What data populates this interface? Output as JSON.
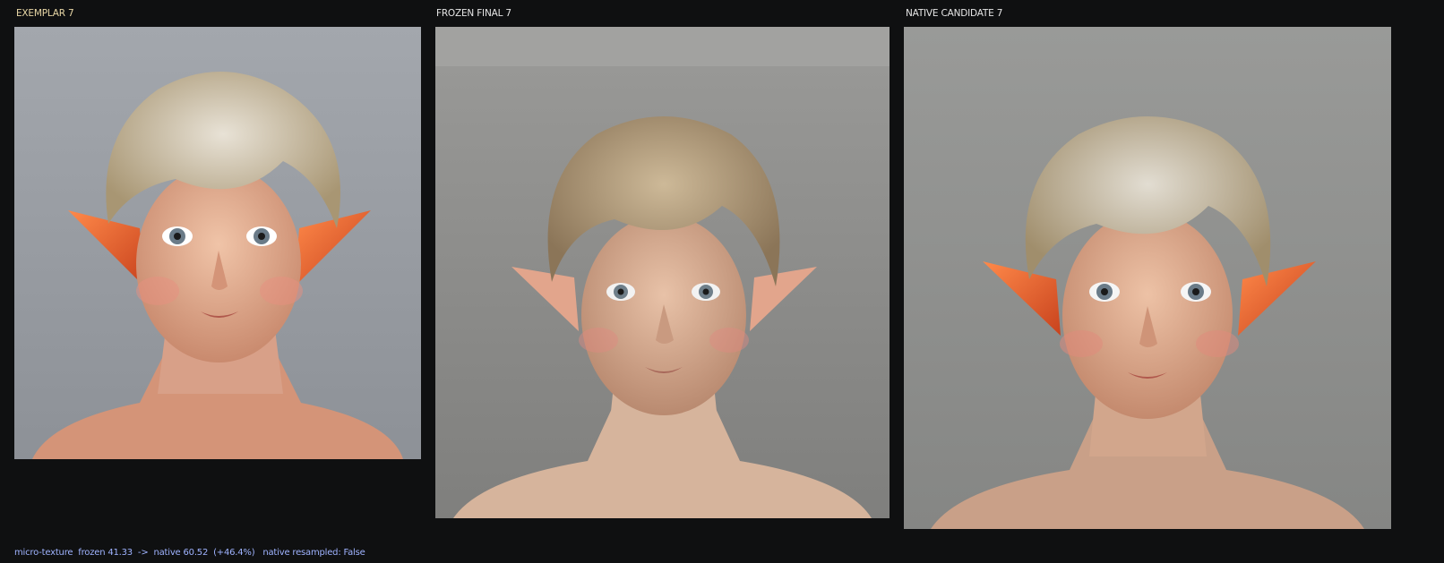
{
  "colors": {
    "background": "#0f1011",
    "exemplar_label": "#e8d7a6",
    "panel_label": "#e6e6e6",
    "footer_text": "#9fb3ff"
  },
  "panels": [
    {
      "label": "EXEMPLAR 7"
    },
    {
      "label": "FROZEN FINAL 7"
    },
    {
      "label": "NATIVE CANDIDATE 7"
    }
  ],
  "footer": "micro-texture  frozen 41.33  ->  native 60.52  (+46.4%)   native resampled: False"
}
